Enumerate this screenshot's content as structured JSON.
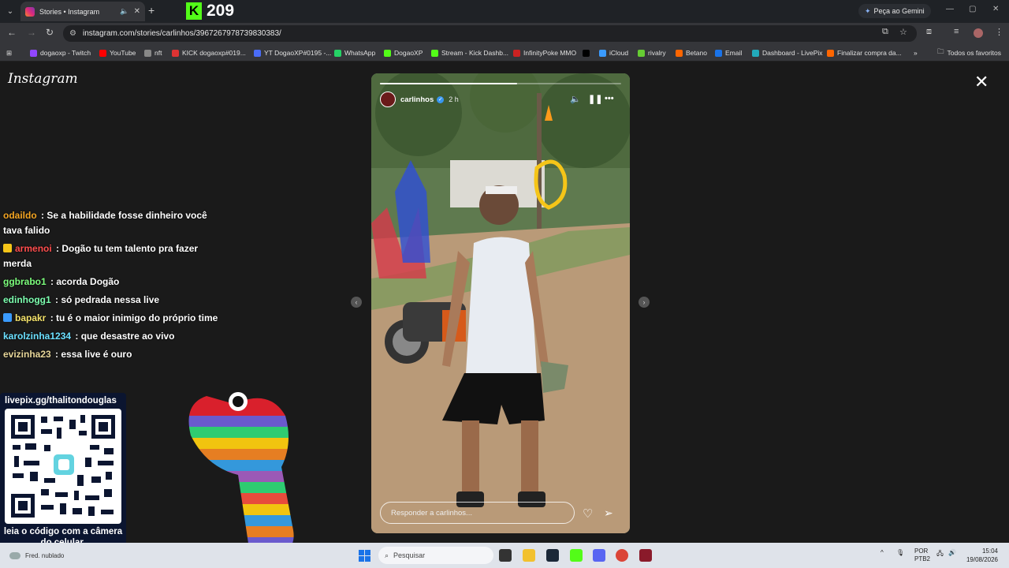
{
  "browser": {
    "tab_title": "Stories • Instagram",
    "kick_counter": "209",
    "gemini_label": "Peça ao Gemini",
    "url": "instagram.com/stories/carlinhos/3967267978739830383/"
  },
  "bookmarks": [
    {
      "label": "dogaoxp - Twitch",
      "color": "#9146ff"
    },
    {
      "label": "YouTube",
      "color": "#ff0000"
    },
    {
      "label": "nft",
      "color": "#888888"
    },
    {
      "label": "KICK dogaoxp#019...",
      "color": "#d33"
    },
    {
      "label": "YT DogaoXP#0195 -...",
      "color": "#4a6cf7"
    },
    {
      "label": "WhatsApp",
      "color": "#25d366"
    },
    {
      "label": "DogaoXP",
      "color": "#53fc18"
    },
    {
      "label": "Stream - Kick Dashb...",
      "color": "#53fc18"
    },
    {
      "label": "InfinityPoke MMO",
      "color": "#c22"
    },
    {
      "label": "",
      "color": "#000000"
    },
    {
      "label": "iCloud",
      "color": "#3a9bff"
    },
    {
      "label": "rivalry",
      "color": "#6c3"
    },
    {
      "label": "Betano",
      "color": "#f60"
    },
    {
      "label": "Email",
      "color": "#1a73e8"
    },
    {
      "label": "Dashboard - LivePix",
      "color": "#2ab"
    },
    {
      "label": "Finalizar compra da...",
      "color": "#f60"
    }
  ],
  "bookmarks_all": "Todos os favoritos",
  "instagram_logo": "Instagram",
  "chat": [
    {
      "user": "odaildo",
      "color": "#f5a623",
      "text": ": Se a habilidade fosse dinheiro você tava falido",
      "badge": ""
    },
    {
      "user": "armenoi",
      "color": "#ff4d4d",
      "text": ": Dogão tu tem talento pra fazer merda",
      "badge": "#f5c518"
    },
    {
      "user": "ggbrabo1",
      "color": "#7dff7d",
      "text": ": acorda Dogão",
      "badge": ""
    },
    {
      "user": "edinhogg1",
      "color": "#7dffb0",
      "text": ": só pedrada nessa live",
      "badge": ""
    },
    {
      "user": "bapakr",
      "color": "#f5e36b",
      "text": ": tu é o maior inimigo do próprio time",
      "badge": "#3a9bff"
    },
    {
      "user": "karolzinha1234",
      "color": "#6be0ff",
      "text": ": que desastre ao vivo",
      "badge": ""
    },
    {
      "user": "evizinha23",
      "color": "#e8d79a",
      "text": ": essa live é ouro",
      "badge": ""
    }
  ],
  "qr": {
    "url": "livepix.gg/thalitondouglas",
    "caption": "leia o código com a câmera do celular."
  },
  "story": {
    "username": "carlinhos",
    "time": "2 h",
    "progress": 0.57,
    "reply_placeholder": "Responder a carlinhos..."
  },
  "taskbar": {
    "weather": "Fred. nublado",
    "search": "Pesquisar",
    "lang": "POR",
    "lang2": "PTB2",
    "time": "15:04",
    "date": "19/08/2026"
  }
}
